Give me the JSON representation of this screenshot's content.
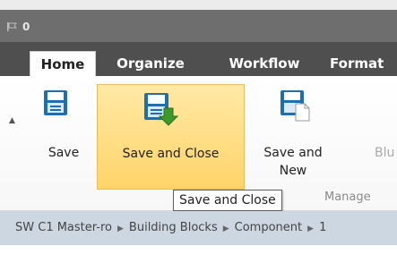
{
  "window": {
    "flag_count": "0"
  },
  "tabs": [
    {
      "label": "Home"
    },
    {
      "label": "Organize"
    },
    {
      "label": "Workflow"
    },
    {
      "label": "Format"
    }
  ],
  "ribbon": {
    "buttons": [
      {
        "label": "Save"
      },
      {
        "label": "Save and Close"
      },
      {
        "label_line1": "Save and",
        "label_line2": "New"
      },
      {
        "label": "Blu"
      }
    ],
    "group_label": "Manage",
    "tooltip": "Save and Close"
  },
  "breadcrumb": [
    "SW C1 Master-ro",
    "Building Blocks",
    "Component",
    "1"
  ]
}
